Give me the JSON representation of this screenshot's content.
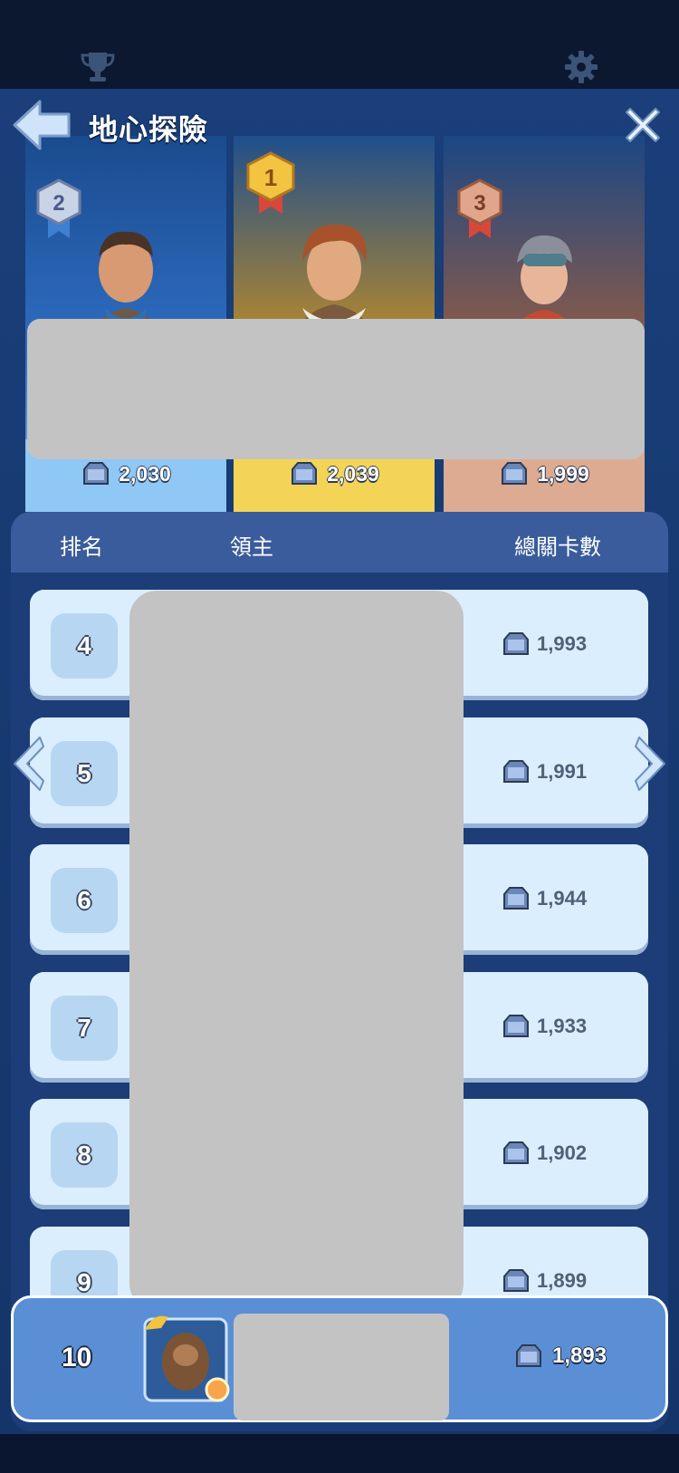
{
  "header": {
    "title": "地心探險",
    "icons": {
      "trophy": "trophy-icon",
      "settings": "gear-icon",
      "back": "back-arrow-icon",
      "close": "close-icon"
    }
  },
  "podium": [
    {
      "rank": "2",
      "score": "2,030",
      "color": "#8fc7f5"
    },
    {
      "rank": "1",
      "score": "2,039",
      "color": "#f3d457"
    },
    {
      "rank": "3",
      "score": "1,999",
      "color": "#ddab92"
    }
  ],
  "list": {
    "headers": {
      "rank": "排名",
      "lord": "領主",
      "total": "總關卡數"
    },
    "rows": [
      {
        "rank": "4",
        "score": "1,993"
      },
      {
        "rank": "5",
        "score": "1,991"
      },
      {
        "rank": "6",
        "score": "1,944"
      },
      {
        "rank": "7",
        "score": "1,933"
      },
      {
        "rank": "8",
        "score": "1,902"
      },
      {
        "rank": "9",
        "score": "1,899"
      }
    ]
  },
  "my_entry": {
    "rank": "10",
    "score": "1,893"
  },
  "colors": {
    "panel": "#173a72",
    "row": "#dbeefd",
    "my_row": "#5a8fd6",
    "score_icon": "#6b87b8"
  }
}
